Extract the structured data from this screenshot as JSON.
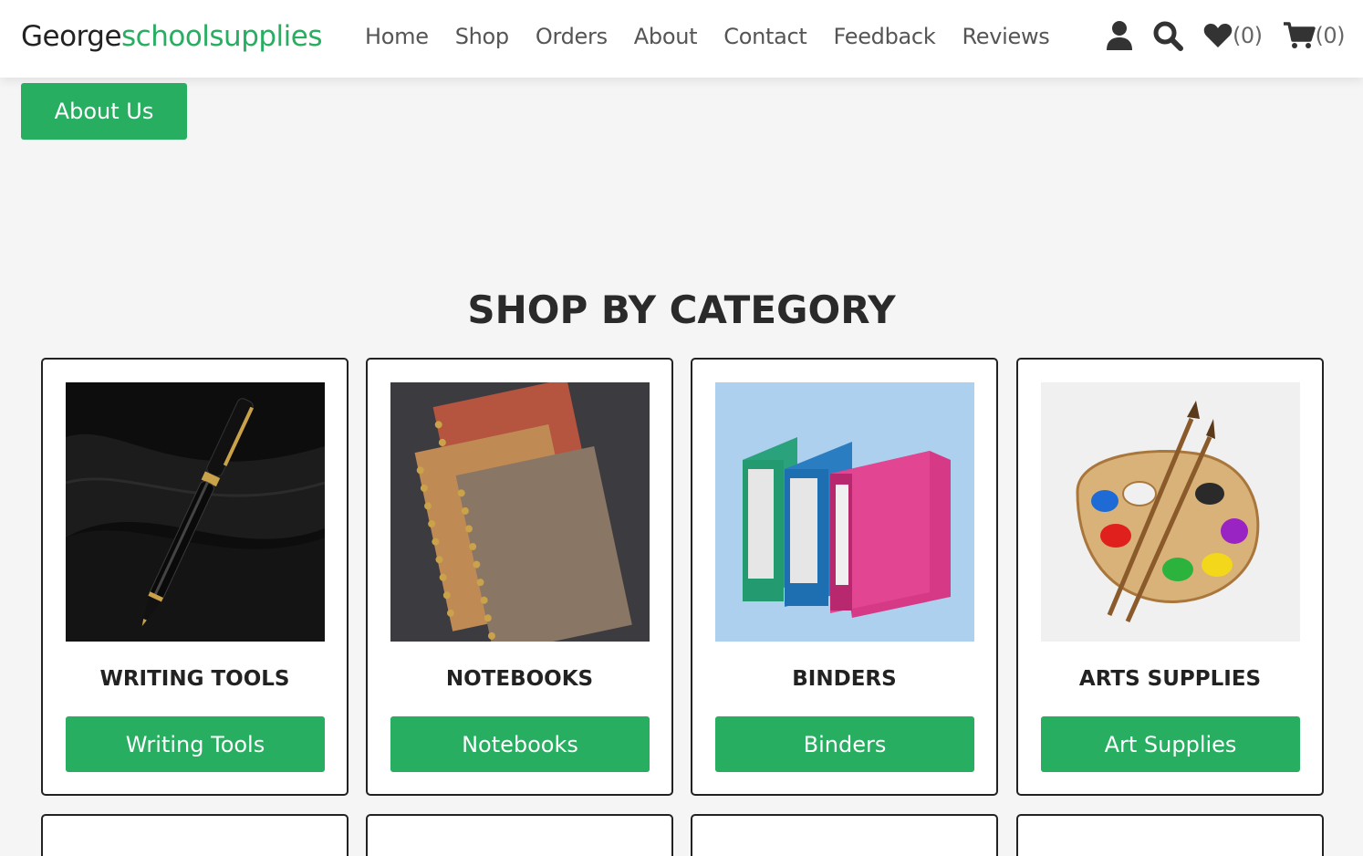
{
  "header": {
    "logo_part1": "George",
    "logo_part2": "schoolsupplies",
    "nav": [
      "Home",
      "Shop",
      "Orders",
      "About",
      "Contact",
      "Feedback",
      "Reviews"
    ],
    "wishlist_count": "(0)",
    "cart_count": "(0)",
    "icons": [
      "user-icon",
      "search-icon",
      "heart-icon",
      "cart-icon"
    ]
  },
  "about_button": "About Us",
  "section_title": "SHOP BY CATEGORY",
  "categories": [
    {
      "title": "WRITING TOOLS",
      "button": "Writing Tools",
      "image": "pen-image"
    },
    {
      "title": "NOTEBOOKS",
      "button": "Notebooks",
      "image": "notebooks-image"
    },
    {
      "title": "BINDERS",
      "button": "Binders",
      "image": "binders-image"
    },
    {
      "title": "ARTS SUPPLIES",
      "button": "Art Supplies",
      "image": "palette-image"
    }
  ],
  "colors": {
    "accent": "#27ae60",
    "background": "#f5f5f5"
  }
}
